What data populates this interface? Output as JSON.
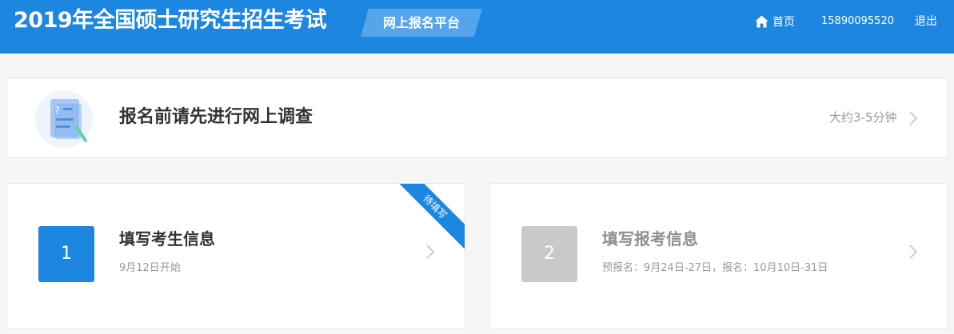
{
  "header": {
    "title": "2019年全国硕士研究生招生考试",
    "platform_badge": "网上报名平台",
    "nav": {
      "home": "首页",
      "phone": "15890095520",
      "logout": "退出"
    },
    "color": "#1c86e0"
  },
  "survey": {
    "title": "报名前请先进行网上调查",
    "time_estimate": "大约3-5分钟"
  },
  "steps": [
    {
      "number": "1",
      "title": "填写考生信息",
      "subtitle": "9月12日开始",
      "ribbon": "待填写",
      "color": "#1c86e0"
    },
    {
      "number": "2",
      "title": "填写报考信息",
      "subtitle": "预报名：9月24日-27日，报名：10月10日-31日",
      "color": "#c9c9c9"
    }
  ]
}
